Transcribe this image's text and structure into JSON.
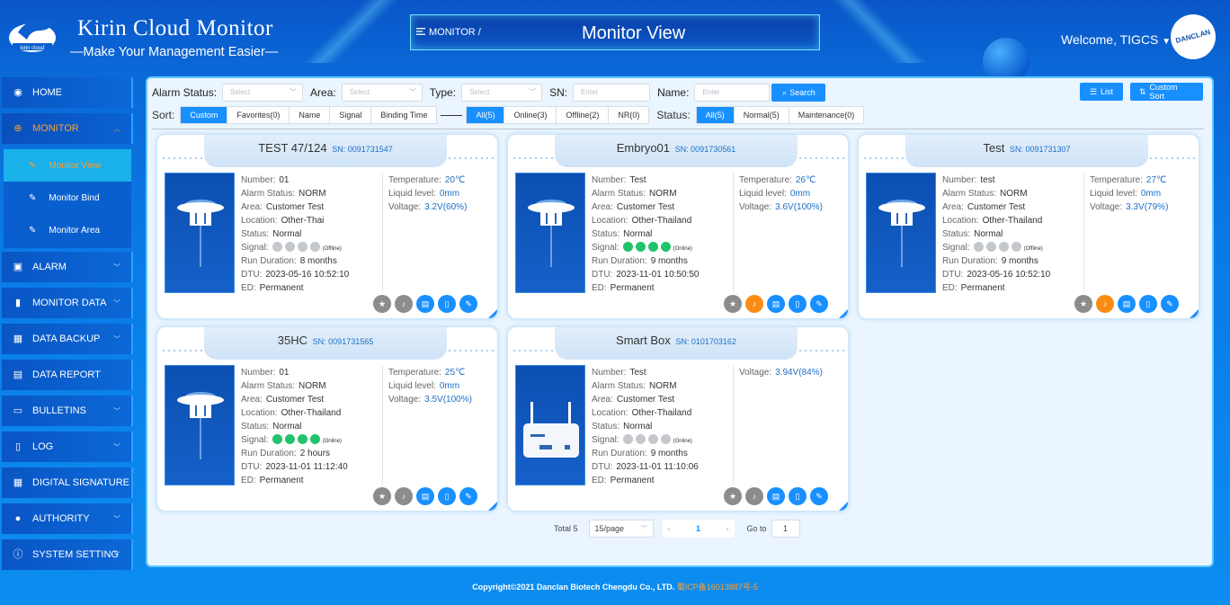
{
  "header": {
    "brand_title": "Kirin Cloud Monitor",
    "brand_subtitle": "—Make Your Management Easier—",
    "logo_text": "kirin cloud",
    "breadcrumb": "MONITOR /",
    "page_title": "Monitor View",
    "welcome": "Welcome, TIGCS",
    "avatar_text": "DANCLAN"
  },
  "sidebar": {
    "items": [
      {
        "label": "HOME",
        "icon": "dashboard-icon"
      },
      {
        "label": "MONITOR",
        "icon": "target-icon"
      },
      {
        "label": "ALARM",
        "icon": "lock-icon"
      },
      {
        "label": "MONITOR DATA",
        "icon": "bar-chart-icon"
      },
      {
        "label": "DATA BACKUP",
        "icon": "grid-icon"
      },
      {
        "label": "DATA REPORT",
        "icon": "report-icon"
      },
      {
        "label": "BULLETINS",
        "icon": "message-icon"
      },
      {
        "label": "LOG",
        "icon": "book-icon"
      },
      {
        "label": "DIGITAL SIGNATURE",
        "icon": "grid-icon"
      },
      {
        "label": "AUTHORITY",
        "icon": "user-icon"
      },
      {
        "label": "SYSTEM SETTING",
        "icon": "info-icon"
      }
    ],
    "monitor_sub": [
      "Monitor View",
      "Monitor Bind",
      "Monitor Area"
    ]
  },
  "filters": {
    "alarm_status_label": "Alarm Status:",
    "area_label": "Area:",
    "type_label": "Type:",
    "sn_label": "SN:",
    "name_label": "Name:",
    "select_placeholder": "Select",
    "enter_placeholder": "Enter",
    "search_label": "Search",
    "list_label": "List",
    "custom_sort_label": "Custom Sort"
  },
  "sort": {
    "label": "Sort:",
    "options": [
      "Custom",
      "Favorites(0)",
      "Name",
      "Signal",
      "Binding Time"
    ],
    "online_options": [
      "All(5)",
      "Online(3)",
      "Offline(2)",
      "NR(0)"
    ],
    "status_label": "Status:",
    "status_options": [
      "All(5)",
      "Normal(5)",
      "Maintenance(0)"
    ]
  },
  "labels": {
    "number": "Number:",
    "alarm_status": "Alarm Status:",
    "area": "Area:",
    "location": "Location:",
    "status": "Status:",
    "signal": "Signal:",
    "run_duration": "Run Duration:",
    "dtu": "DTU:",
    "ed": "ED:",
    "temperature": "Temperature:",
    "liquid_level": "Liquid level:",
    "voltage": "Voltage:",
    "sn_prefix": "SN:"
  },
  "cards": [
    {
      "name": "TEST 47/124",
      "sn": "0091731547",
      "number": "01",
      "alarm_status": "NORM",
      "area": "Customer Test",
      "location": "Other-Thai",
      "status": "Normal",
      "signal_bars": 0,
      "signal_text": "(Offline)",
      "run_duration": "8 months",
      "dtu": "2023-05-16 10:52:10",
      "ed": "Permanent",
      "temperature": "20℃",
      "liquid_level": "0mm",
      "voltage": "3.2V(60%)",
      "device": "sensor",
      "alarm_active": false
    },
    {
      "name": "Embryo01",
      "sn": "0091730561",
      "number": "Test",
      "alarm_status": "NORM",
      "area": "Customer Test",
      "location": "Other-Thailand",
      "status": "Normal",
      "signal_bars": 4,
      "signal_text": "(Online)",
      "run_duration": "9 months",
      "dtu": "2023-11-01 10:50:50",
      "ed": "Permanent",
      "temperature": "26℃",
      "liquid_level": "0mm",
      "voltage": "3.6V(100%)",
      "device": "sensor",
      "alarm_active": true
    },
    {
      "name": "Test",
      "sn": "0091731307",
      "number": "test",
      "alarm_status": "NORM",
      "area": "Customer Test",
      "location": "Other-Thailand",
      "status": "Normal",
      "signal_bars": 0,
      "signal_text": "(Offline)",
      "run_duration": "9 months",
      "dtu": "2023-05-16 10:52:10",
      "ed": "Permanent",
      "temperature": "27℃",
      "liquid_level": "0mm",
      "voltage": "3.3V(79%)",
      "device": "sensor",
      "alarm_active": true
    },
    {
      "name": "35HC",
      "sn": "0091731565",
      "number": "01",
      "alarm_status": "NORM",
      "area": "Customer Test",
      "location": "Other-Thailand",
      "status": "Normal",
      "signal_bars": 4,
      "signal_text": "(Online)",
      "run_duration": "2 hours",
      "dtu": "2023-11-01 11:12:40",
      "ed": "Permanent",
      "temperature": "25℃",
      "liquid_level": "0mm",
      "voltage": "3.5V(100%)",
      "device": "sensor",
      "alarm_active": false
    },
    {
      "name": "Smart Box",
      "sn": "0101703162",
      "number": "Test",
      "alarm_status": "NORM",
      "area": "Customer Test",
      "location": "Other-Thailand",
      "status": "Normal",
      "signal_bars": 0,
      "signal_text": "(Online)",
      "run_duration": "9 months",
      "dtu": "2023-11-01 11:10:06",
      "ed": "Permanent",
      "temperature": "",
      "liquid_level": "",
      "voltage": "3.94V(84%)",
      "device": "router",
      "alarm_active": false
    }
  ],
  "pagination": {
    "total": "Total 5",
    "page_size": "15/page",
    "current_page": "1",
    "goto_label": "Go to",
    "goto_value": "1"
  },
  "footer": {
    "copyright": "Copyright©2021 Danclan Biotech Chengdu Co., LTD.",
    "icp": "蜀ICP备16013887号-5"
  },
  "colors": {
    "accent": "#1890ff",
    "active_menu": "#ff9e2c",
    "online": "#21c36b",
    "offline": "#c4c8cc",
    "alarm": "#fa8c16"
  }
}
